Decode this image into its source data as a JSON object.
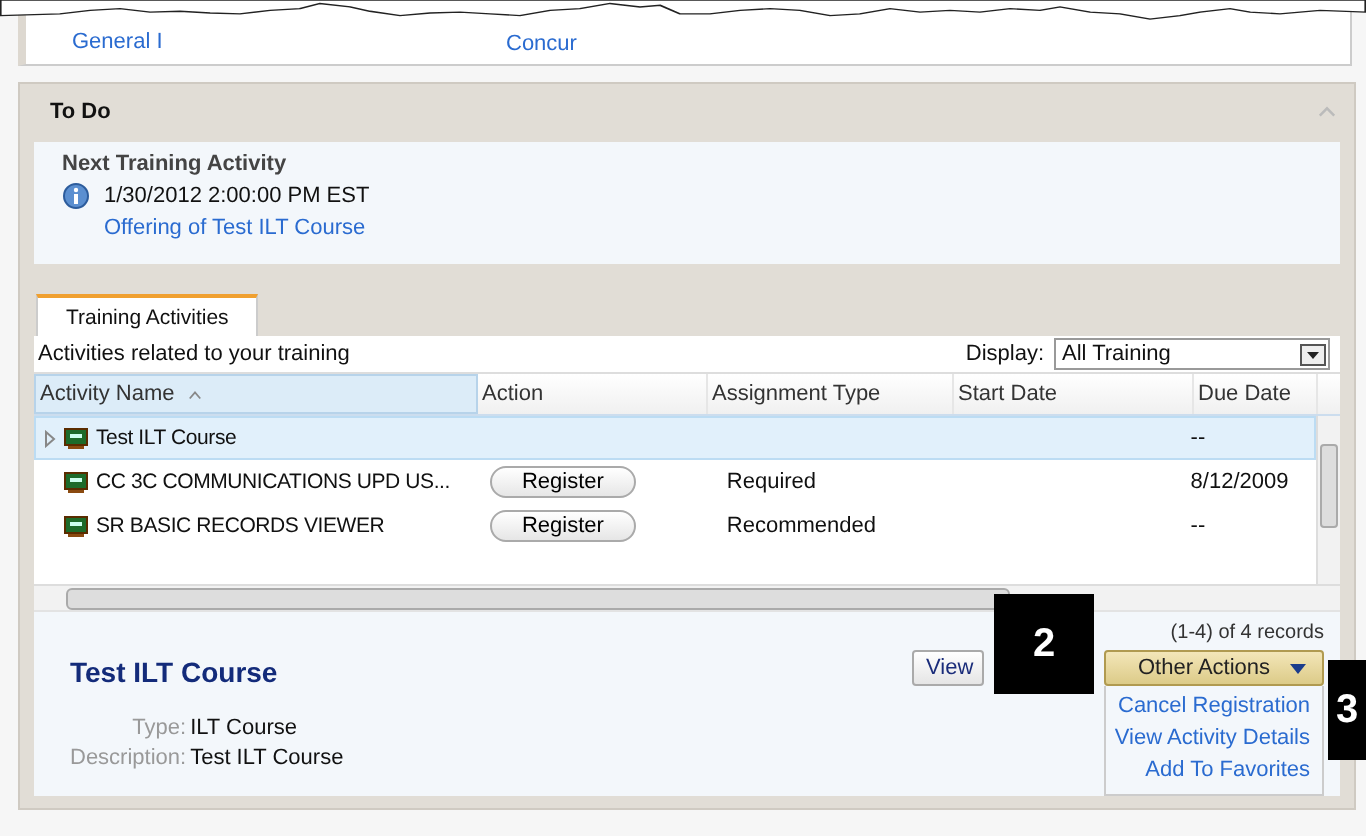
{
  "top_links": [
    "General I",
    "Concur"
  ],
  "panel": {
    "title": "To Do",
    "collapsed": false
  },
  "next_activity": {
    "heading": "Next Training Activity",
    "datetime": "1/30/2012  2:00:00 PM EST",
    "link": "Offering of Test ILT Course"
  },
  "tabs": [
    {
      "label": "Training Activities",
      "selected": true
    }
  ],
  "toolbar": {
    "caption": "Activities related to your training",
    "display_label": "Display:",
    "display_value": "All Training"
  },
  "table": {
    "columns": [
      {
        "label": "Activity Name",
        "sorted": true
      },
      {
        "label": "Action",
        "sorted": false
      },
      {
        "label": "Assignment Type",
        "sorted": false
      },
      {
        "label": "Start Date",
        "sorted": false
      },
      {
        "label": "Due Date",
        "sorted": false
      }
    ],
    "rows": [
      {
        "name": "Test ILT Course",
        "action": "",
        "assignment_type": "",
        "start_date": "",
        "due_date": "--",
        "selected": true,
        "expandable": true
      },
      {
        "name": "CC 3C COMMUNICATIONS UPD US...",
        "action": "Register",
        "assignment_type": "Required",
        "start_date": "",
        "due_date": "8/12/2009",
        "selected": false,
        "expandable": false
      },
      {
        "name": "SR BASIC RECORDS VIEWER",
        "action": "Register",
        "assignment_type": "Recommended",
        "start_date": "",
        "due_date": "--",
        "selected": false,
        "expandable": false
      }
    ]
  },
  "records": "(1-4) of 4 records",
  "details": {
    "title": "Test ILT Course",
    "fields": [
      {
        "label": "Type:",
        "value": "ILT Course"
      },
      {
        "label": "Description:",
        "value": "Test ILT Course"
      }
    ]
  },
  "buttons": {
    "view": "View",
    "other_actions": "Other Actions"
  },
  "menu": {
    "expanded": true,
    "items": [
      "Cancel Registration",
      "View Activity Details",
      "Add To Favorites"
    ]
  },
  "callouts": [
    "2",
    "3"
  ]
}
